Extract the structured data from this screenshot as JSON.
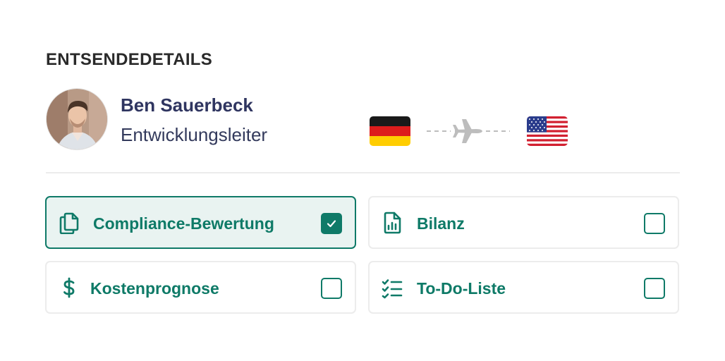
{
  "section": {
    "title": "ENTSENDEDETAILS"
  },
  "person": {
    "name": "Ben Sauerbeck",
    "role": "Entwicklungsleiter"
  },
  "route": {
    "origin_flag": "germany-flag-icon",
    "transport_icon": "airplane-icon",
    "destination_flag": "usa-flag-icon"
  },
  "options": [
    {
      "label": "Compliance-Bewertung",
      "icon": "copy-documents-icon",
      "checked": true
    },
    {
      "label": "Bilanz",
      "icon": "bar-chart-file-icon",
      "checked": false
    },
    {
      "label": "Kostenprognose",
      "icon": "dollar-icon",
      "checked": false
    },
    {
      "label": "To-Do-Liste",
      "icon": "checklist-icon",
      "checked": false
    }
  ],
  "colors": {
    "accent": "#0f7a68",
    "selected_bg": "#e9f3f1",
    "name_color": "#2f3560"
  }
}
